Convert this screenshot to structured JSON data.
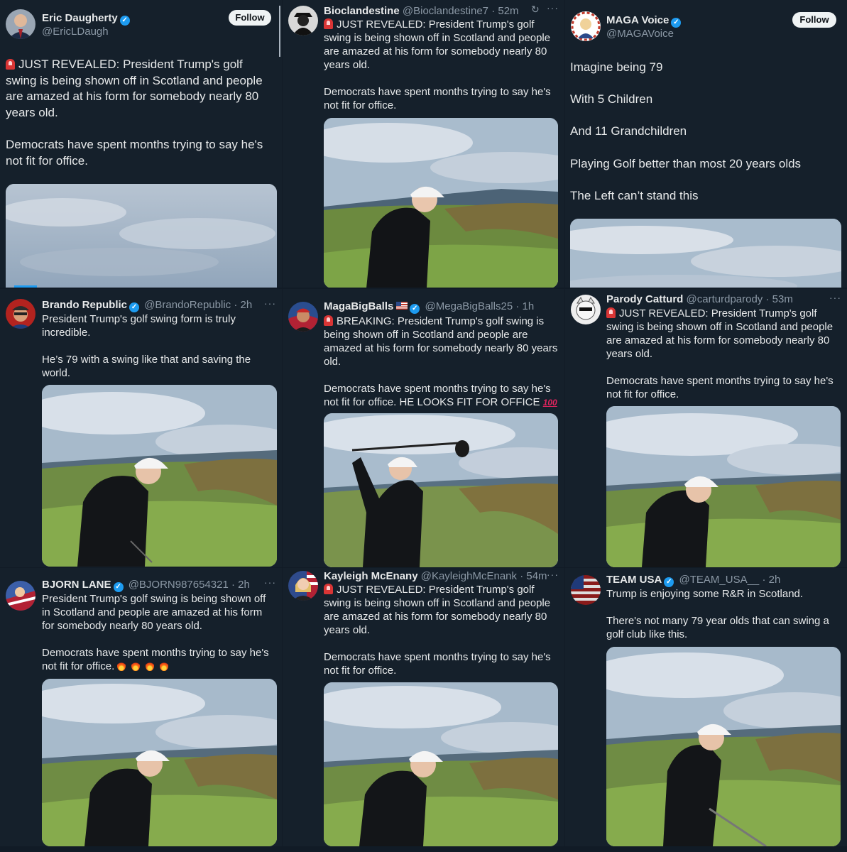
{
  "posts": [
    {
      "name": "Eric Daugherty",
      "handle": "@EricLDaugh",
      "time": "",
      "follow": "Follow",
      "paragraphs": [
        "JUST REVEALED: President Trump's golf swing is being shown off in Scotland and people are amazed at his form for somebody nearly 80 years old.",
        "Democrats have spent months trying to say he's not fit for office."
      ]
    },
    {
      "name": "Bioclandestine",
      "handle": "@Bioclandestine7",
      "time": "· 52m",
      "paragraphs": [
        "JUST REVEALED: President Trump's golf swing is being shown off in Scotland and people are amazed at his form for somebody nearly 80 years old.",
        "Democrats have spent months trying to say he's not fit for office."
      ]
    },
    {
      "name": "MAGA Voice",
      "handle": "@MAGAVoice",
      "time": "",
      "follow": "Follow",
      "paragraphs": [
        "Imagine being 79",
        "With 5 Children",
        "And 11 Grandchildren",
        "Playing Golf better than most 20 years olds",
        "The Left can’t stand this"
      ]
    },
    {
      "name": "Brando Republic",
      "handle": "@BrandoRepublic",
      "time": "· 2h",
      "paragraphs": [
        "President Trump's golf swing form is truly incredible.",
        "He’s 79 with a swing like that and saving the world."
      ]
    },
    {
      "name": "MagaBigBalls",
      "handle": "@MegaBigBalls25",
      "time": "· 1h",
      "paragraphs": [
        "BREAKING: President Trump's golf swing is being shown off in Scotland and people are amazed at his form for somebody nearly 80 years old.",
        "Democrats have spent months trying to say he's not fit for office. HE LOOKS FIT FOR OFFICE"
      ],
      "emoji_100": "100"
    },
    {
      "name": "Parody Catturd",
      "handle": "@carturdparody",
      "time": "· 53m",
      "paragraphs": [
        "JUST REVEALED: President Trump's golf swing is being shown off in Scotland and people are amazed at his form for somebody nearly 80 years old.",
        "Democrats have spent months trying to say he's not fit for office."
      ]
    },
    {
      "name": "BJORN LANE",
      "handle": "@BJORN987654321",
      "time": "· 2h",
      "paragraphs": [
        "President Trump's golf swing is being shown off in Scotland and people are amazed at his form for somebody nearly 80 years old.",
        "Democrats have spent months trying to say he's not fit for office."
      ]
    },
    {
      "name": "Kayleigh McEnany",
      "handle": "@KayleighMcEnank",
      "time": "· 54m",
      "paragraphs": [
        "JUST REVEALED: President Trump's golf swing is being shown off in Scotland and people are amazed at his form for somebody nearly 80 years old.",
        "Democrats have spent months trying to say he's not fit for office."
      ]
    },
    {
      "name": "TEAM USA",
      "handle": "@TEAM_USA__",
      "time": "· 2h",
      "paragraphs": [
        "Trump is enjoying some R&R in Scotland.",
        "There's not many 79 year olds that can swing a golf club like this."
      ]
    }
  ],
  "colors": {
    "background": "#15202b",
    "text": "#e7e9ea",
    "muted": "#8b98a5",
    "verified": "#1d9bf0"
  }
}
